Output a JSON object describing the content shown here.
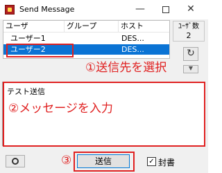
{
  "window": {
    "title": "Send Message",
    "minimize_glyph": "—",
    "close_glyph": "✕"
  },
  "user_list": {
    "columns": [
      "ユーザ",
      "グループ",
      "ホスト"
    ],
    "rows": [
      {
        "user": "ユーザー1",
        "group": "",
        "host": "DES...",
        "selected": false
      },
      {
        "user": "ユーザー2",
        "group": "",
        "host": "DES...",
        "selected": true
      }
    ]
  },
  "side_panel": {
    "count_label": "ﾕｰｻﾞ数",
    "count_value": "2",
    "refresh_glyph": "↻",
    "dropdown_glyph": "▼"
  },
  "message": {
    "body": "テスト送信"
  },
  "footer": {
    "send_label": "送信",
    "seal_label": "封書",
    "seal_checked": true,
    "seal_check_glyph": "✓"
  },
  "annotations": {
    "step1": "①送信先を選択",
    "step2": "②メッセージを入力",
    "step3": "③",
    "color": "#e02020"
  },
  "colors": {
    "selection": "#0a73d4",
    "focus_border": "#0078d7"
  }
}
